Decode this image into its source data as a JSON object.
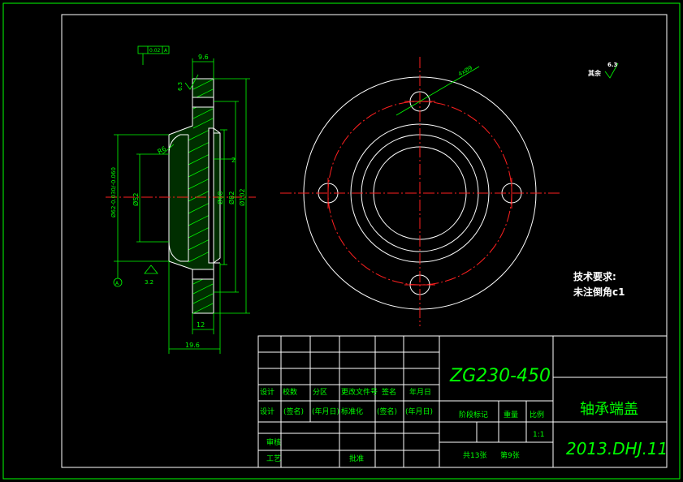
{
  "drawing": {
    "part_code": "ZG230-450",
    "part_name": "轴承端盖",
    "drawing_number": "2013.DHJ.11",
    "scale": "1:1",
    "sheets_total": "共13张",
    "sheet_no": "第9张"
  },
  "title_block": {
    "row1": [
      "设计",
      "校数",
      "分区",
      "更改文件号",
      "签名",
      "年月日"
    ],
    "row2": [
      "设计",
      "(签名)",
      "(年月日)",
      "标准化",
      "(签名)",
      "(年月日)"
    ],
    "review": "审核",
    "process": "工艺",
    "approve": "批准",
    "stage_mark": "阶段标记",
    "weight": "重量",
    "scale_label": "比例"
  },
  "notes": {
    "heading": "技术要求:",
    "line1": "未注倒角c1",
    "roughness_label": "其余"
  },
  "dimensions": {
    "d_flange_thk": "9.6",
    "d_total_len": "19.6",
    "d_hub_len": "12",
    "d_step": "2",
    "d_fillet": "R6",
    "d_dia_52": "Ø52",
    "d_dia_62": "Ø62-0.030/-0.060",
    "d_dia_60": "Ø60",
    "d_dia_82": "Ø82",
    "d_dia_102": "Ø102",
    "d_holes": "4xØ9",
    "rough_left": "3.2",
    "rough_top": "6.3",
    "rough_main": "6.3",
    "datum": "A",
    "gdt_tol": "0.02",
    "gdt_ref": "A"
  }
}
